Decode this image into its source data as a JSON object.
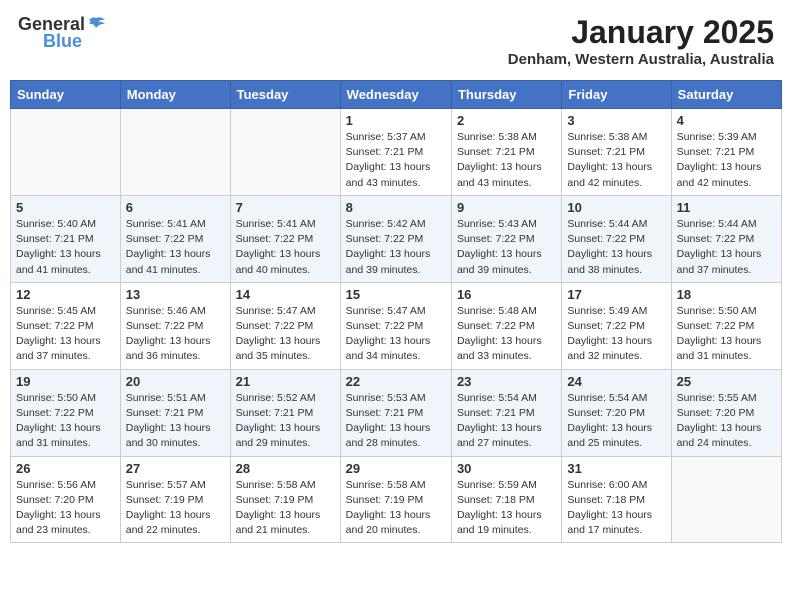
{
  "header": {
    "logo_general": "General",
    "logo_blue": "Blue",
    "title": "January 2025",
    "location": "Denham, Western Australia, Australia"
  },
  "weekdays": [
    "Sunday",
    "Monday",
    "Tuesday",
    "Wednesday",
    "Thursday",
    "Friday",
    "Saturday"
  ],
  "weeks": [
    [
      {
        "day": "",
        "info": ""
      },
      {
        "day": "",
        "info": ""
      },
      {
        "day": "",
        "info": ""
      },
      {
        "day": "1",
        "info": "Sunrise: 5:37 AM\nSunset: 7:21 PM\nDaylight: 13 hours\nand 43 minutes."
      },
      {
        "day": "2",
        "info": "Sunrise: 5:38 AM\nSunset: 7:21 PM\nDaylight: 13 hours\nand 43 minutes."
      },
      {
        "day": "3",
        "info": "Sunrise: 5:38 AM\nSunset: 7:21 PM\nDaylight: 13 hours\nand 42 minutes."
      },
      {
        "day": "4",
        "info": "Sunrise: 5:39 AM\nSunset: 7:21 PM\nDaylight: 13 hours\nand 42 minutes."
      }
    ],
    [
      {
        "day": "5",
        "info": "Sunrise: 5:40 AM\nSunset: 7:21 PM\nDaylight: 13 hours\nand 41 minutes."
      },
      {
        "day": "6",
        "info": "Sunrise: 5:41 AM\nSunset: 7:22 PM\nDaylight: 13 hours\nand 41 minutes."
      },
      {
        "day": "7",
        "info": "Sunrise: 5:41 AM\nSunset: 7:22 PM\nDaylight: 13 hours\nand 40 minutes."
      },
      {
        "day": "8",
        "info": "Sunrise: 5:42 AM\nSunset: 7:22 PM\nDaylight: 13 hours\nand 39 minutes."
      },
      {
        "day": "9",
        "info": "Sunrise: 5:43 AM\nSunset: 7:22 PM\nDaylight: 13 hours\nand 39 minutes."
      },
      {
        "day": "10",
        "info": "Sunrise: 5:44 AM\nSunset: 7:22 PM\nDaylight: 13 hours\nand 38 minutes."
      },
      {
        "day": "11",
        "info": "Sunrise: 5:44 AM\nSunset: 7:22 PM\nDaylight: 13 hours\nand 37 minutes."
      }
    ],
    [
      {
        "day": "12",
        "info": "Sunrise: 5:45 AM\nSunset: 7:22 PM\nDaylight: 13 hours\nand 37 minutes."
      },
      {
        "day": "13",
        "info": "Sunrise: 5:46 AM\nSunset: 7:22 PM\nDaylight: 13 hours\nand 36 minutes."
      },
      {
        "day": "14",
        "info": "Sunrise: 5:47 AM\nSunset: 7:22 PM\nDaylight: 13 hours\nand 35 minutes."
      },
      {
        "day": "15",
        "info": "Sunrise: 5:47 AM\nSunset: 7:22 PM\nDaylight: 13 hours\nand 34 minutes."
      },
      {
        "day": "16",
        "info": "Sunrise: 5:48 AM\nSunset: 7:22 PM\nDaylight: 13 hours\nand 33 minutes."
      },
      {
        "day": "17",
        "info": "Sunrise: 5:49 AM\nSunset: 7:22 PM\nDaylight: 13 hours\nand 32 minutes."
      },
      {
        "day": "18",
        "info": "Sunrise: 5:50 AM\nSunset: 7:22 PM\nDaylight: 13 hours\nand 31 minutes."
      }
    ],
    [
      {
        "day": "19",
        "info": "Sunrise: 5:50 AM\nSunset: 7:22 PM\nDaylight: 13 hours\nand 31 minutes."
      },
      {
        "day": "20",
        "info": "Sunrise: 5:51 AM\nSunset: 7:21 PM\nDaylight: 13 hours\nand 30 minutes."
      },
      {
        "day": "21",
        "info": "Sunrise: 5:52 AM\nSunset: 7:21 PM\nDaylight: 13 hours\nand 29 minutes."
      },
      {
        "day": "22",
        "info": "Sunrise: 5:53 AM\nSunset: 7:21 PM\nDaylight: 13 hours\nand 28 minutes."
      },
      {
        "day": "23",
        "info": "Sunrise: 5:54 AM\nSunset: 7:21 PM\nDaylight: 13 hours\nand 27 minutes."
      },
      {
        "day": "24",
        "info": "Sunrise: 5:54 AM\nSunset: 7:20 PM\nDaylight: 13 hours\nand 25 minutes."
      },
      {
        "day": "25",
        "info": "Sunrise: 5:55 AM\nSunset: 7:20 PM\nDaylight: 13 hours\nand 24 minutes."
      }
    ],
    [
      {
        "day": "26",
        "info": "Sunrise: 5:56 AM\nSunset: 7:20 PM\nDaylight: 13 hours\nand 23 minutes."
      },
      {
        "day": "27",
        "info": "Sunrise: 5:57 AM\nSunset: 7:19 PM\nDaylight: 13 hours\nand 22 minutes."
      },
      {
        "day": "28",
        "info": "Sunrise: 5:58 AM\nSunset: 7:19 PM\nDaylight: 13 hours\nand 21 minutes."
      },
      {
        "day": "29",
        "info": "Sunrise: 5:58 AM\nSunset: 7:19 PM\nDaylight: 13 hours\nand 20 minutes."
      },
      {
        "day": "30",
        "info": "Sunrise: 5:59 AM\nSunset: 7:18 PM\nDaylight: 13 hours\nand 19 minutes."
      },
      {
        "day": "31",
        "info": "Sunrise: 6:00 AM\nSunset: 7:18 PM\nDaylight: 13 hours\nand 17 minutes."
      },
      {
        "day": "",
        "info": ""
      }
    ]
  ]
}
